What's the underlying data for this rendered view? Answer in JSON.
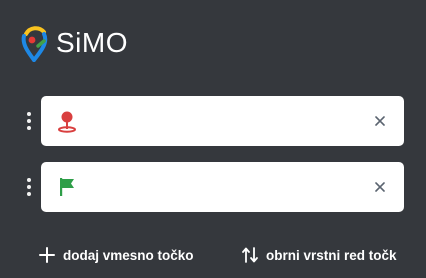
{
  "brand": {
    "name": "SiMO",
    "logo_icon": "map-pin-logo-icon",
    "colors": {
      "blue": "#1e88e5",
      "yellow": "#f9c31f",
      "red": "#e53935",
      "green": "#43a047"
    }
  },
  "route": {
    "origin": {
      "icon": "start-pin-icon",
      "icon_color": "#d93f3f",
      "value": "",
      "placeholder": "",
      "clear_icon": "close-icon"
    },
    "destination": {
      "icon": "flag-icon",
      "icon_color": "#2e9e48",
      "value": "",
      "placeholder": "",
      "clear_icon": "close-icon"
    }
  },
  "actions": {
    "add_waypoint": {
      "label": "dodaj vmesno točko",
      "icon": "plus-icon"
    },
    "reverse_order": {
      "label": "obrni vrstni red točk",
      "icon": "swap-vertical-icon"
    }
  }
}
